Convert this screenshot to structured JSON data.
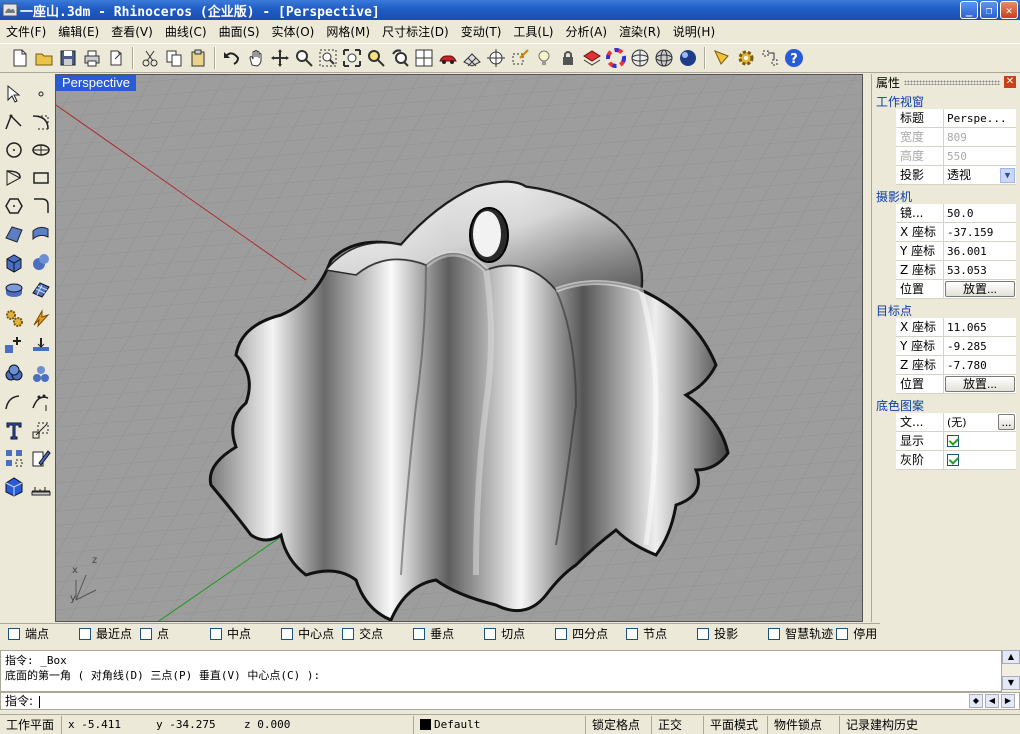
{
  "window": {
    "title": "一座山.3dm - Rhinoceros (企业版) - [Perspective]",
    "buttons": [
      "_",
      "❐",
      "✕"
    ]
  },
  "menu": [
    "文件(F)",
    "编辑(E)",
    "查看(V)",
    "曲线(C)",
    "曲面(S)",
    "实体(O)",
    "网格(M)",
    "尺寸标注(D)",
    "变动(T)",
    "工具(L)",
    "分析(A)",
    "渲染(R)",
    "说明(H)"
  ],
  "viewport": {
    "label": "Perspective",
    "axis": {
      "x": "x",
      "y": "y",
      "z": "z"
    }
  },
  "panel": {
    "title": "属性",
    "close": "✕",
    "sections": {
      "viewport": {
        "label": "工作视窗",
        "rows": [
          {
            "k": "标题",
            "v": "Perspe..."
          },
          {
            "k": "宽度",
            "v": "809"
          },
          {
            "k": "高度",
            "v": "550"
          },
          {
            "k": "投影",
            "v": "透视"
          }
        ]
      },
      "camera": {
        "label": "摄影机",
        "rows": [
          {
            "k": "镜...",
            "v": "50.0"
          },
          {
            "k": "X 座标",
            "v": "-37.159"
          },
          {
            "k": "Y 座标",
            "v": "36.001"
          },
          {
            "k": "Z 座标",
            "v": "53.053"
          },
          {
            "k": "位置",
            "v": "放置..."
          }
        ]
      },
      "target": {
        "label": "目标点",
        "rows": [
          {
            "k": "X 座标",
            "v": "11.065"
          },
          {
            "k": "Y 座标",
            "v": "-9.285"
          },
          {
            "k": "Z 座标",
            "v": "-7.780"
          },
          {
            "k": "位置",
            "v": "放置..."
          }
        ]
      },
      "background": {
        "label": "底色图案",
        "rows": [
          {
            "k": "文...",
            "v": "(无)",
            "btn": "..."
          },
          {
            "k": "显示",
            "checked": true
          },
          {
            "k": "灰阶",
            "checked": true
          }
        ]
      }
    }
  },
  "osnaps": [
    {
      "label": "端点",
      "checked": false
    },
    {
      "label": "最近点",
      "checked": false
    },
    {
      "label": "点",
      "checked": false
    },
    {
      "label": "中点",
      "checked": false
    },
    {
      "label": "中心点",
      "checked": false
    },
    {
      "label": "交点",
      "checked": false
    },
    {
      "label": "垂点",
      "checked": false
    },
    {
      "label": "切点",
      "checked": false
    },
    {
      "label": "四分点",
      "checked": false
    },
    {
      "label": "节点",
      "checked": false
    },
    {
      "label": "投影",
      "checked": false
    },
    {
      "label": "智慧轨迹",
      "checked": false
    },
    {
      "label": "停用",
      "checked": false
    }
  ],
  "command": {
    "history": [
      "指令: _Box",
      "底面的第一角 ( 对角线(D) 三点(P) 垂直(V) 中心点(C) ):"
    ],
    "prompt": "指令:"
  },
  "status": {
    "cplane": "工作平面",
    "x": "x -5.411",
    "y": "y -34.275",
    "z": "z 0.000",
    "layer": "Default",
    "layer_color": "#000000",
    "toggles": [
      "锁定格点",
      "正交",
      "平面模式",
      "物件锁点",
      "记录建构历史"
    ]
  }
}
